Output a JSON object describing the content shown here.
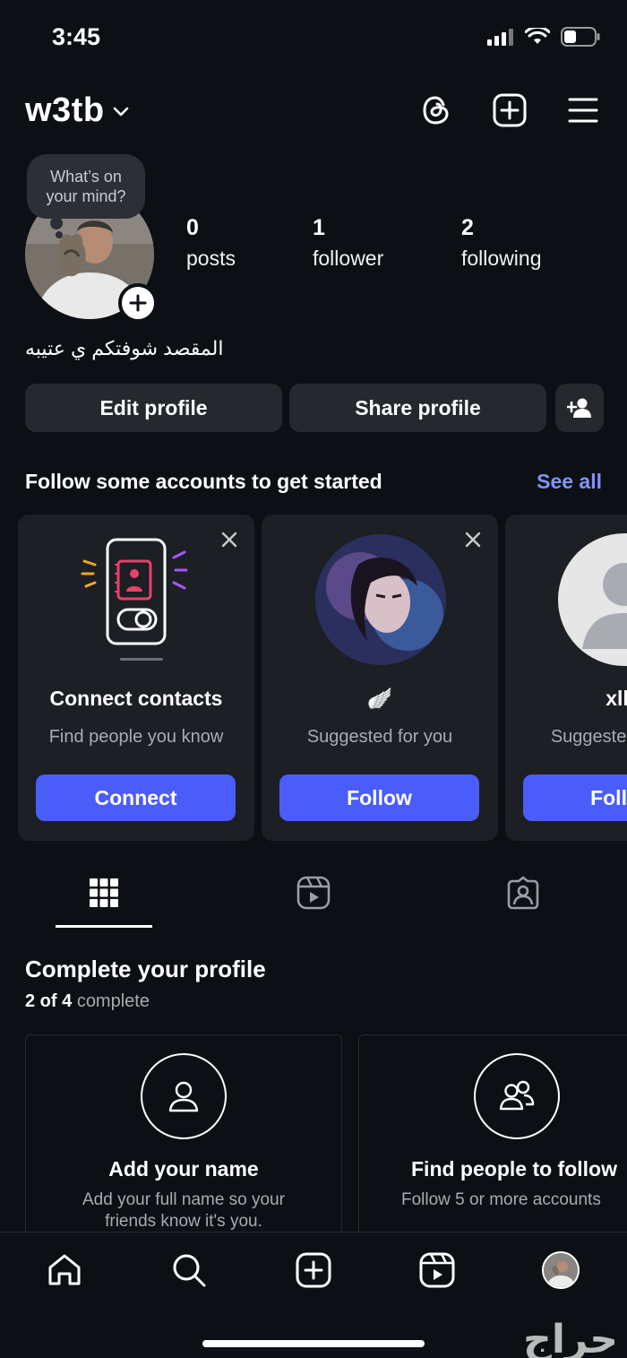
{
  "status": {
    "time": "3:45"
  },
  "header": {
    "username": "w3tb"
  },
  "note": {
    "text_line1": "What’s on",
    "text_line2": "your mind?"
  },
  "stats": [
    {
      "value": "0",
      "label": "posts"
    },
    {
      "value": "1",
      "label": "follower"
    },
    {
      "value": "2",
      "label": "following"
    }
  ],
  "bio": "المقصد شوفتكم ي عتيبه",
  "buttons": {
    "edit": "Edit profile",
    "share": "Share profile"
  },
  "suggestions": {
    "title": "Follow some accounts to get started",
    "see_all": "See all",
    "cards": [
      {
        "title": "Connect contacts",
        "subtitle": "Find people you know",
        "button": "Connect"
      },
      {
        "title": "🪽",
        "subtitle": "Suggested for you",
        "button": "Follow"
      },
      {
        "title": "xllq",
        "subtitle": "Suggested for you",
        "button": "Follow"
      }
    ]
  },
  "complete_profile": {
    "title": "Complete your profile",
    "progress_count": "2 of 4",
    "progress_word": "complete",
    "cards": [
      {
        "title": "Add your name",
        "subtitle_line1": "Add your full name so your",
        "subtitle_line2": "friends know it's you."
      },
      {
        "title": "Find people to follow",
        "subtitle_line1": "Follow 5 or more accounts",
        "subtitle_line2": ""
      }
    ]
  },
  "watermark": "حراج",
  "colors": {
    "background": "#0c1014",
    "accent_button": "#4a5df9",
    "link": "#7f95ff",
    "surface": "#25292e"
  }
}
